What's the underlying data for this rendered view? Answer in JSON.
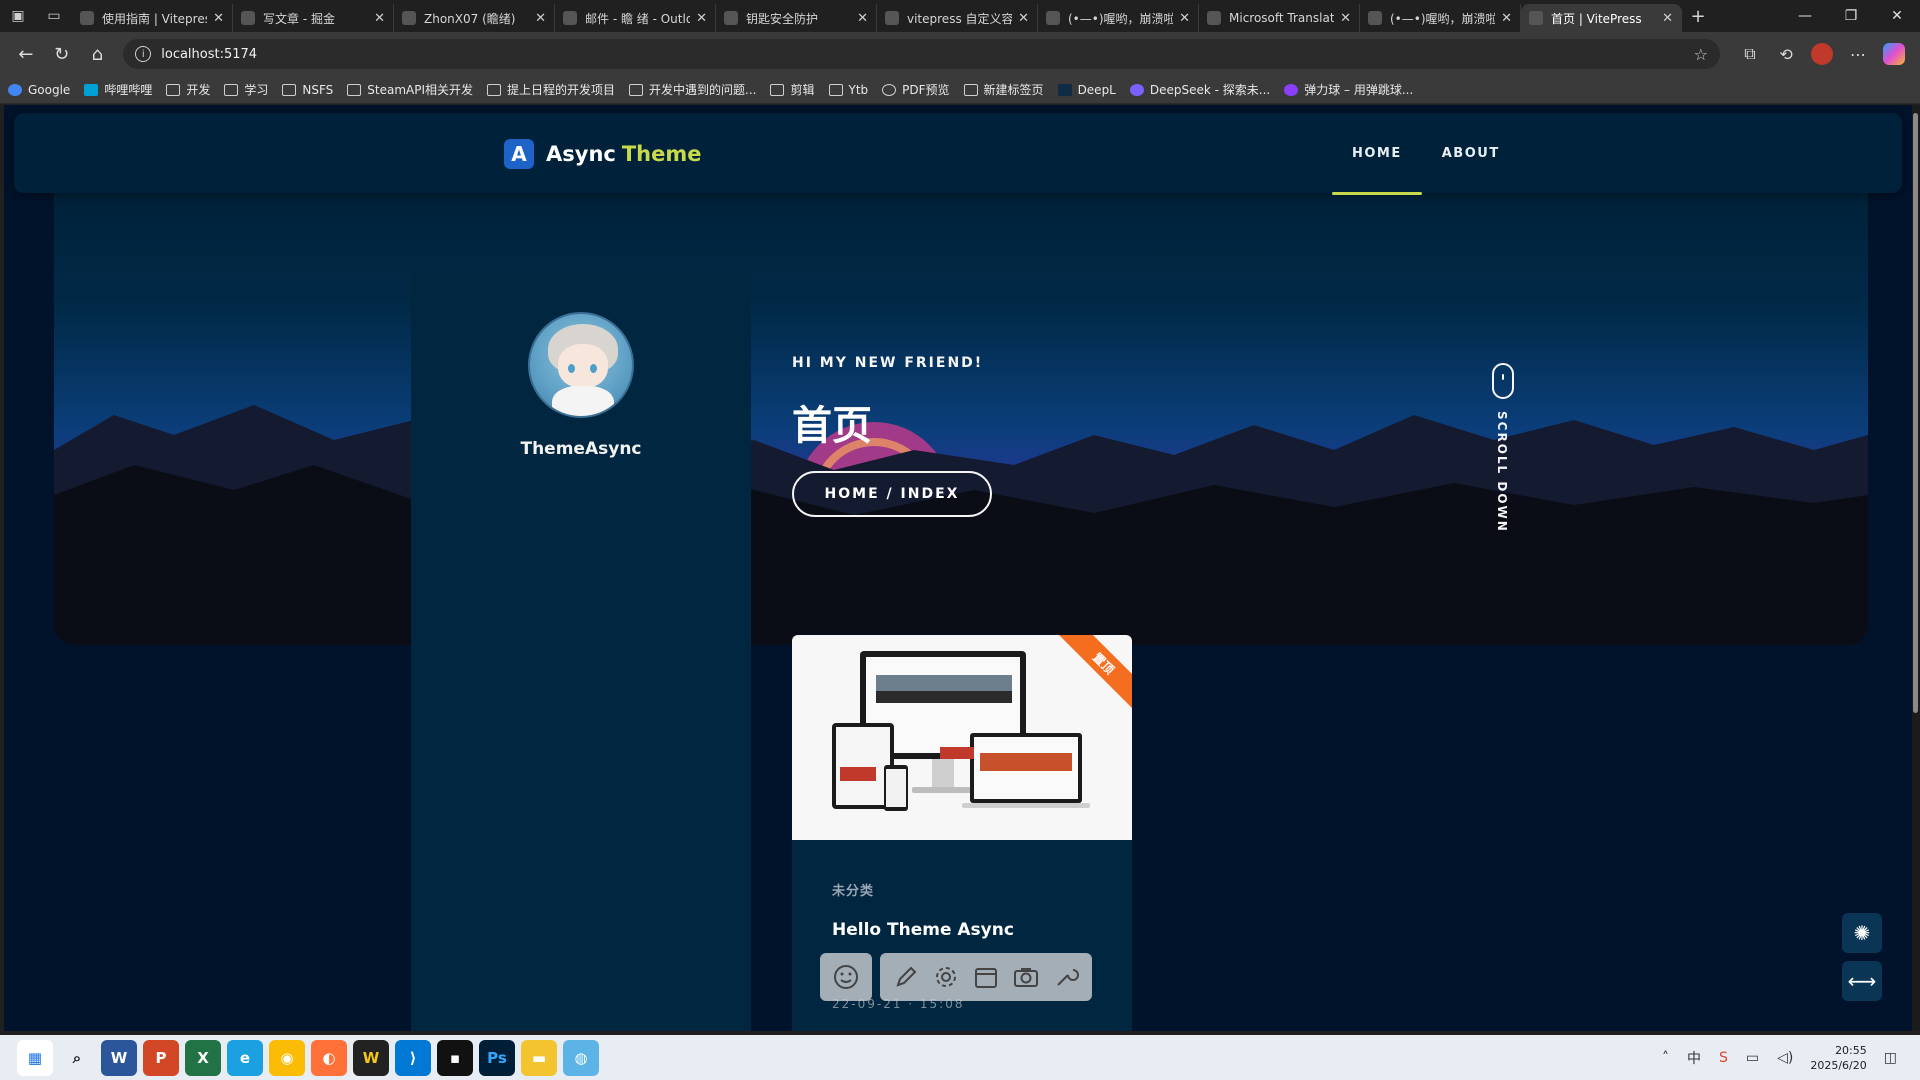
{
  "browser": {
    "tabs": [
      {
        "title": "使用指南 | Vitepress",
        "icon": "A"
      },
      {
        "title": "写文章 - 掘金",
        "icon": "globe"
      },
      {
        "title": "ZhonX07 (瞻绪)",
        "icon": "github"
      },
      {
        "title": "邮件 - 瞻 绪 - Outlook",
        "icon": "outlook"
      },
      {
        "title": "钥匙安全防护",
        "icon": "globe"
      },
      {
        "title": "vitepress 自定义容器",
        "icon": "search"
      },
      {
        "title": "(•—•)喔哟，崩溃啦",
        "icon": "page"
      },
      {
        "title": "Microsoft Translator",
        "icon": "translator"
      },
      {
        "title": "(•—•)喔哟，崩溃啦",
        "icon": "B"
      },
      {
        "title": "首页 | VitePress",
        "icon": "vitepress",
        "active": true
      }
    ],
    "url": "localhost:5174",
    "bookmarks": [
      {
        "label": "Google",
        "icon": "google"
      },
      {
        "label": "哔哩哔哩",
        "icon": "bilibili"
      },
      {
        "label": "开发",
        "icon": "folder"
      },
      {
        "label": "学习",
        "icon": "folder"
      },
      {
        "label": "NSFS",
        "icon": "folder"
      },
      {
        "label": "SteamAPI相关开发",
        "icon": "folder"
      },
      {
        "label": "提上日程的开发项目",
        "icon": "folder"
      },
      {
        "label": "开发中遇到的问题...",
        "icon": "folder"
      },
      {
        "label": "剪辑",
        "icon": "folder"
      },
      {
        "label": "Ytb",
        "icon": "folder"
      },
      {
        "label": "PDF预览",
        "icon": "globe"
      },
      {
        "label": "新建标签页",
        "icon": "page"
      },
      {
        "label": "DeepL",
        "icon": "deepl"
      },
      {
        "label": "DeepSeek - 探索未...",
        "icon": "deepseek"
      },
      {
        "label": "弹力球 – 用弹跳球...",
        "icon": "ball"
      }
    ]
  },
  "site": {
    "logo_mark": "A",
    "logo_text_primary": "Async",
    "logo_text_accent": "Theme",
    "nav": [
      {
        "label": "HOME",
        "active": true
      },
      {
        "label": "ABOUT",
        "active": false
      }
    ],
    "profile_name": "ThemeAsync",
    "hero": {
      "greeting": "HI MY NEW FRIEND!",
      "title": "首页",
      "breadcrumb": "HOME / INDEX",
      "scroll_hint": "SCROLL DOWN"
    },
    "post": {
      "ribbon": "置顶",
      "category": "未分类",
      "title": "Hello Theme Async",
      "date": "22-09-21 · 15:08"
    },
    "fabs": [
      "settings-icon",
      "width-toggle-icon"
    ]
  },
  "toolbar_icons": [
    "smile-icon",
    "pencil-icon",
    "gear-icon",
    "calendar-icon",
    "camera-icon",
    "wrench-icon"
  ],
  "taskbar": {
    "time": "20:55",
    "date": "2025/6/20"
  },
  "colors": {
    "accent": "#c8d94a",
    "page_bg": "#00132a",
    "card_bg": "#002640",
    "ribbon": "#f56d1f"
  }
}
